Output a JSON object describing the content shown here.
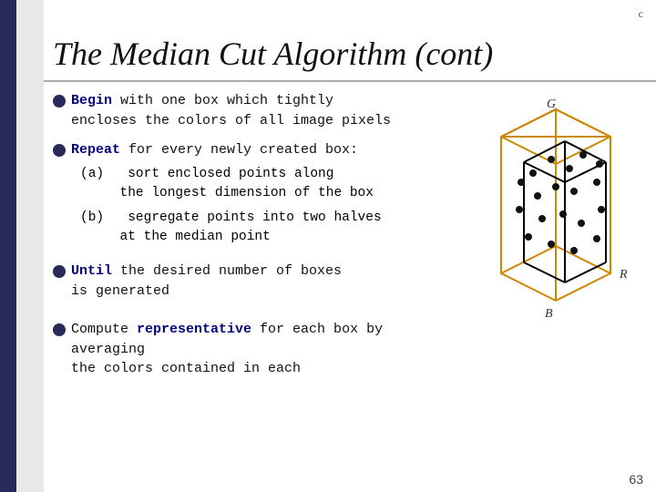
{
  "slide": {
    "title": "The Median Cut Algorithm (cont)",
    "page_number": "63",
    "bullets": [
      {
        "id": "bullet1",
        "keyword": "Begin",
        "text": " with one box which tightly\nencloses the colors of all image pixels"
      },
      {
        "id": "bullet2",
        "keyword": "Repeat",
        "text": " for every newly created box:"
      },
      {
        "id": "bullet3",
        "keyword": "Until",
        "text": " the desired number of boxes\nis generated"
      },
      {
        "id": "bullet4",
        "text": "Compute ",
        "keyword2": "representative",
        "text2": " for each box by averaging\nthe colors contained in each"
      }
    ],
    "sub_items": [
      {
        "label": "(a)",
        "text": "sort enclosed points along\n    the longest dimension of the box"
      },
      {
        "label": "(b)",
        "text": "segregate points into two halves\n    at the median point"
      }
    ],
    "diagram": {
      "axis_g": "G",
      "axis_r": "R",
      "axis_b": "B"
    }
  }
}
